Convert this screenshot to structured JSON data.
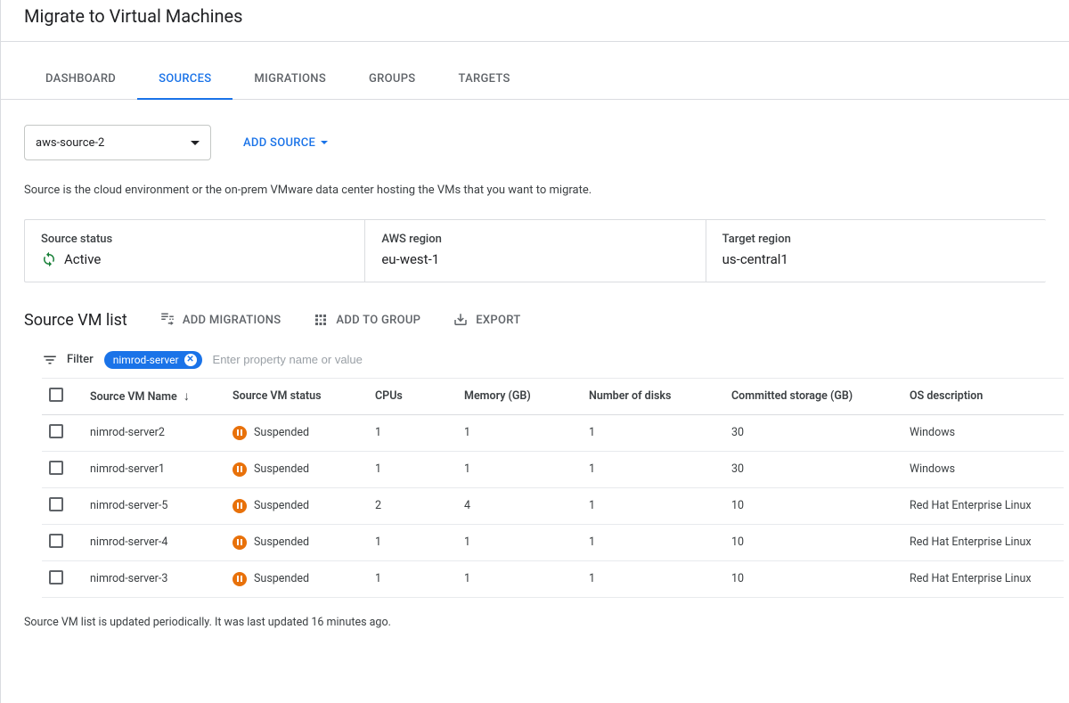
{
  "page_title": "Migrate to Virtual Machines",
  "tabs": [
    "DASHBOARD",
    "SOURCES",
    "MIGRATIONS",
    "GROUPS",
    "TARGETS"
  ],
  "active_tab_index": 1,
  "source_select": "aws-source-2",
  "add_source_label": "ADD SOURCE",
  "description": "Source is the cloud environment or the on-prem VMware data center hosting the VMs that you want to migrate.",
  "status_cards": {
    "source_status_label": "Source status",
    "source_status_value": "Active",
    "aws_region_label": "AWS region",
    "aws_region_value": "eu-west-1",
    "target_region_label": "Target region",
    "target_region_value": "us-central1"
  },
  "section_title": "Source VM list",
  "actions": {
    "add_migrations": "ADD MIGRATIONS",
    "add_to_group": "ADD TO GROUP",
    "export": "EXPORT"
  },
  "filter_label": "Filter",
  "filter_chip": "nimrod-server",
  "filter_placeholder": "Enter property name or value",
  "columns": {
    "name": "Source VM Name",
    "status": "Source VM status",
    "cpus": "CPUs",
    "memory": "Memory (GB)",
    "disks": "Number of disks",
    "storage": "Committed storage (GB)",
    "os": "OS description"
  },
  "rows": [
    {
      "name": "nimrod-server2",
      "status": "Suspended",
      "cpus": "1",
      "memory": "1",
      "disks": "1",
      "storage": "30",
      "os": "Windows"
    },
    {
      "name": "nimrod-server1",
      "status": "Suspended",
      "cpus": "1",
      "memory": "1",
      "disks": "1",
      "storage": "30",
      "os": "Windows"
    },
    {
      "name": "nimrod-server-5",
      "status": "Suspended",
      "cpus": "2",
      "memory": "4",
      "disks": "1",
      "storage": "10",
      "os": "Red Hat Enterprise Linux"
    },
    {
      "name": "nimrod-server-4",
      "status": "Suspended",
      "cpus": "1",
      "memory": "1",
      "disks": "1",
      "storage": "10",
      "os": "Red Hat Enterprise Linux"
    },
    {
      "name": "nimrod-server-3",
      "status": "Suspended",
      "cpus": "1",
      "memory": "1",
      "disks": "1",
      "storage": "10",
      "os": "Red Hat Enterprise Linux"
    }
  ],
  "footer_note": "Source VM list is updated periodically. It was last updated 16 minutes ago."
}
